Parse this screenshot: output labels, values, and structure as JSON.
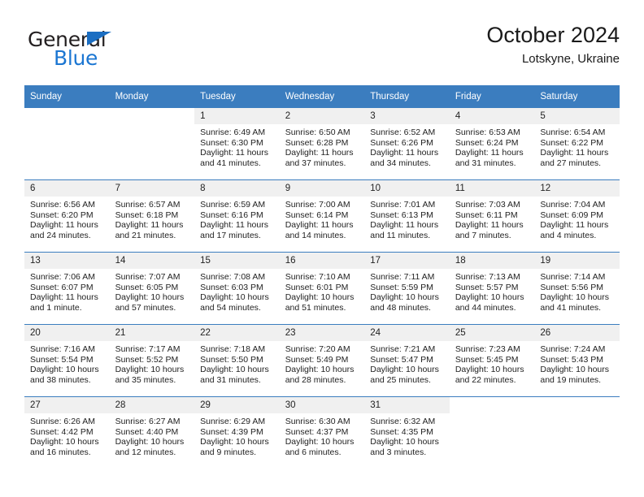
{
  "brand": {
    "name_part1": "General",
    "name_part2": "Blue",
    "accent_color": "#1b76d2",
    "triangle_color": "#1b6ec2"
  },
  "header": {
    "title": "October 2024",
    "subtitle": "Lotskyne, Ukraine"
  },
  "calendar": {
    "header_color": "#3b7dbf",
    "daynum_bg": "#f0f0f0",
    "weekday_headers": [
      "Sunday",
      "Monday",
      "Tuesday",
      "Wednesday",
      "Thursday",
      "Friday",
      "Saturday"
    ],
    "weeks": [
      [
        {
          "day": "",
          "empty": true,
          "sunrise": "",
          "sunset": "",
          "daylight1": "",
          "daylight2": ""
        },
        {
          "day": "",
          "empty": true,
          "sunrise": "",
          "sunset": "",
          "daylight1": "",
          "daylight2": ""
        },
        {
          "day": "1",
          "sunrise": "Sunrise: 6:49 AM",
          "sunset": "Sunset: 6:30 PM",
          "daylight1": "Daylight: 11 hours",
          "daylight2": "and 41 minutes."
        },
        {
          "day": "2",
          "sunrise": "Sunrise: 6:50 AM",
          "sunset": "Sunset: 6:28 PM",
          "daylight1": "Daylight: 11 hours",
          "daylight2": "and 37 minutes."
        },
        {
          "day": "3",
          "sunrise": "Sunrise: 6:52 AM",
          "sunset": "Sunset: 6:26 PM",
          "daylight1": "Daylight: 11 hours",
          "daylight2": "and 34 minutes."
        },
        {
          "day": "4",
          "sunrise": "Sunrise: 6:53 AM",
          "sunset": "Sunset: 6:24 PM",
          "daylight1": "Daylight: 11 hours",
          "daylight2": "and 31 minutes."
        },
        {
          "day": "5",
          "sunrise": "Sunrise: 6:54 AM",
          "sunset": "Sunset: 6:22 PM",
          "daylight1": "Daylight: 11 hours",
          "daylight2": "and 27 minutes."
        }
      ],
      [
        {
          "day": "6",
          "sunrise": "Sunrise: 6:56 AM",
          "sunset": "Sunset: 6:20 PM",
          "daylight1": "Daylight: 11 hours",
          "daylight2": "and 24 minutes."
        },
        {
          "day": "7",
          "sunrise": "Sunrise: 6:57 AM",
          "sunset": "Sunset: 6:18 PM",
          "daylight1": "Daylight: 11 hours",
          "daylight2": "and 21 minutes."
        },
        {
          "day": "8",
          "sunrise": "Sunrise: 6:59 AM",
          "sunset": "Sunset: 6:16 PM",
          "daylight1": "Daylight: 11 hours",
          "daylight2": "and 17 minutes."
        },
        {
          "day": "9",
          "sunrise": "Sunrise: 7:00 AM",
          "sunset": "Sunset: 6:14 PM",
          "daylight1": "Daylight: 11 hours",
          "daylight2": "and 14 minutes."
        },
        {
          "day": "10",
          "sunrise": "Sunrise: 7:01 AM",
          "sunset": "Sunset: 6:13 PM",
          "daylight1": "Daylight: 11 hours",
          "daylight2": "and 11 minutes."
        },
        {
          "day": "11",
          "sunrise": "Sunrise: 7:03 AM",
          "sunset": "Sunset: 6:11 PM",
          "daylight1": "Daylight: 11 hours",
          "daylight2": "and 7 minutes."
        },
        {
          "day": "12",
          "sunrise": "Sunrise: 7:04 AM",
          "sunset": "Sunset: 6:09 PM",
          "daylight1": "Daylight: 11 hours",
          "daylight2": "and 4 minutes."
        }
      ],
      [
        {
          "day": "13",
          "sunrise": "Sunrise: 7:06 AM",
          "sunset": "Sunset: 6:07 PM",
          "daylight1": "Daylight: 11 hours",
          "daylight2": "and 1 minute."
        },
        {
          "day": "14",
          "sunrise": "Sunrise: 7:07 AM",
          "sunset": "Sunset: 6:05 PM",
          "daylight1": "Daylight: 10 hours",
          "daylight2": "and 57 minutes."
        },
        {
          "day": "15",
          "sunrise": "Sunrise: 7:08 AM",
          "sunset": "Sunset: 6:03 PM",
          "daylight1": "Daylight: 10 hours",
          "daylight2": "and 54 minutes."
        },
        {
          "day": "16",
          "sunrise": "Sunrise: 7:10 AM",
          "sunset": "Sunset: 6:01 PM",
          "daylight1": "Daylight: 10 hours",
          "daylight2": "and 51 minutes."
        },
        {
          "day": "17",
          "sunrise": "Sunrise: 7:11 AM",
          "sunset": "Sunset: 5:59 PM",
          "daylight1": "Daylight: 10 hours",
          "daylight2": "and 48 minutes."
        },
        {
          "day": "18",
          "sunrise": "Sunrise: 7:13 AM",
          "sunset": "Sunset: 5:57 PM",
          "daylight1": "Daylight: 10 hours",
          "daylight2": "and 44 minutes."
        },
        {
          "day": "19",
          "sunrise": "Sunrise: 7:14 AM",
          "sunset": "Sunset: 5:56 PM",
          "daylight1": "Daylight: 10 hours",
          "daylight2": "and 41 minutes."
        }
      ],
      [
        {
          "day": "20",
          "sunrise": "Sunrise: 7:16 AM",
          "sunset": "Sunset: 5:54 PM",
          "daylight1": "Daylight: 10 hours",
          "daylight2": "and 38 minutes."
        },
        {
          "day": "21",
          "sunrise": "Sunrise: 7:17 AM",
          "sunset": "Sunset: 5:52 PM",
          "daylight1": "Daylight: 10 hours",
          "daylight2": "and 35 minutes."
        },
        {
          "day": "22",
          "sunrise": "Sunrise: 7:18 AM",
          "sunset": "Sunset: 5:50 PM",
          "daylight1": "Daylight: 10 hours",
          "daylight2": "and 31 minutes."
        },
        {
          "day": "23",
          "sunrise": "Sunrise: 7:20 AM",
          "sunset": "Sunset: 5:49 PM",
          "daylight1": "Daylight: 10 hours",
          "daylight2": "and 28 minutes."
        },
        {
          "day": "24",
          "sunrise": "Sunrise: 7:21 AM",
          "sunset": "Sunset: 5:47 PM",
          "daylight1": "Daylight: 10 hours",
          "daylight2": "and 25 minutes."
        },
        {
          "day": "25",
          "sunrise": "Sunrise: 7:23 AM",
          "sunset": "Sunset: 5:45 PM",
          "daylight1": "Daylight: 10 hours",
          "daylight2": "and 22 minutes."
        },
        {
          "day": "26",
          "sunrise": "Sunrise: 7:24 AM",
          "sunset": "Sunset: 5:43 PM",
          "daylight1": "Daylight: 10 hours",
          "daylight2": "and 19 minutes."
        }
      ],
      [
        {
          "day": "27",
          "sunrise": "Sunrise: 6:26 AM",
          "sunset": "Sunset: 4:42 PM",
          "daylight1": "Daylight: 10 hours",
          "daylight2": "and 16 minutes."
        },
        {
          "day": "28",
          "sunrise": "Sunrise: 6:27 AM",
          "sunset": "Sunset: 4:40 PM",
          "daylight1": "Daylight: 10 hours",
          "daylight2": "and 12 minutes."
        },
        {
          "day": "29",
          "sunrise": "Sunrise: 6:29 AM",
          "sunset": "Sunset: 4:39 PM",
          "daylight1": "Daylight: 10 hours",
          "daylight2": "and 9 minutes."
        },
        {
          "day": "30",
          "sunrise": "Sunrise: 6:30 AM",
          "sunset": "Sunset: 4:37 PM",
          "daylight1": "Daylight: 10 hours",
          "daylight2": "and 6 minutes."
        },
        {
          "day": "31",
          "sunrise": "Sunrise: 6:32 AM",
          "sunset": "Sunset: 4:35 PM",
          "daylight1": "Daylight: 10 hours",
          "daylight2": "and 3 minutes."
        },
        {
          "day": "",
          "empty": true,
          "sunrise": "",
          "sunset": "",
          "daylight1": "",
          "daylight2": ""
        },
        {
          "day": "",
          "empty": true,
          "sunrise": "",
          "sunset": "",
          "daylight1": "",
          "daylight2": ""
        }
      ]
    ]
  }
}
